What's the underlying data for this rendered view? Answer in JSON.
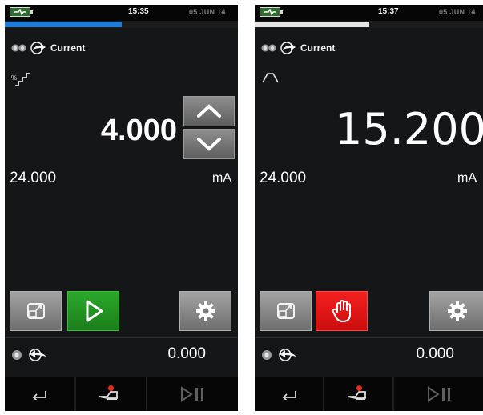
{
  "screens": [
    {
      "status": {
        "time": "15:35",
        "date": "05 JUN 14",
        "progress_fraction": 0.5
      },
      "mode": {
        "label": "Current",
        "icons": [
          "channel-icon",
          "output-arrow-icon"
        ]
      },
      "function_icon": "step-icon",
      "function_icon_label": "%",
      "set_value": "4.000",
      "range": "24.000",
      "unit": "mA",
      "stepper": {
        "up_icon": "chevron-up-icon",
        "down_icon": "chevron-down-icon"
      },
      "buttons": {
        "left_icon": "expand-icon",
        "action_icon": "play-icon",
        "action_color": "#22a022",
        "settings_icon": "gear-icon"
      },
      "measure": {
        "icons": [
          "channel-icon",
          "input-arrow-icon"
        ],
        "value": "0.000"
      },
      "nav": {
        "back_icon": "back-arrow-icon",
        "sensor_icon": "sensor-alert-icon",
        "play_pause_icon": "play-pause-icon"
      }
    },
    {
      "status": {
        "time": "15:37",
        "date": "05 JUN 14",
        "progress_fraction": 0.5
      },
      "mode": {
        "label": "Current",
        "icons": [
          "channel-icon",
          "output-arrow-icon"
        ]
      },
      "function_icon": "ramp-icon",
      "set_value": "15.200",
      "range": "24.000",
      "unit": "mA",
      "buttons": {
        "left_icon": "expand-icon",
        "action_icon": "stop-hand-icon",
        "action_color": "#e81414",
        "settings_icon": "gear-icon"
      },
      "measure": {
        "icons": [
          "channel-icon",
          "input-arrow-icon"
        ],
        "value": "0.000"
      },
      "nav": {
        "back_icon": "back-arrow-icon",
        "sensor_icon": "sensor-alert-icon",
        "play_pause_icon": "play-pause-icon"
      }
    }
  ]
}
